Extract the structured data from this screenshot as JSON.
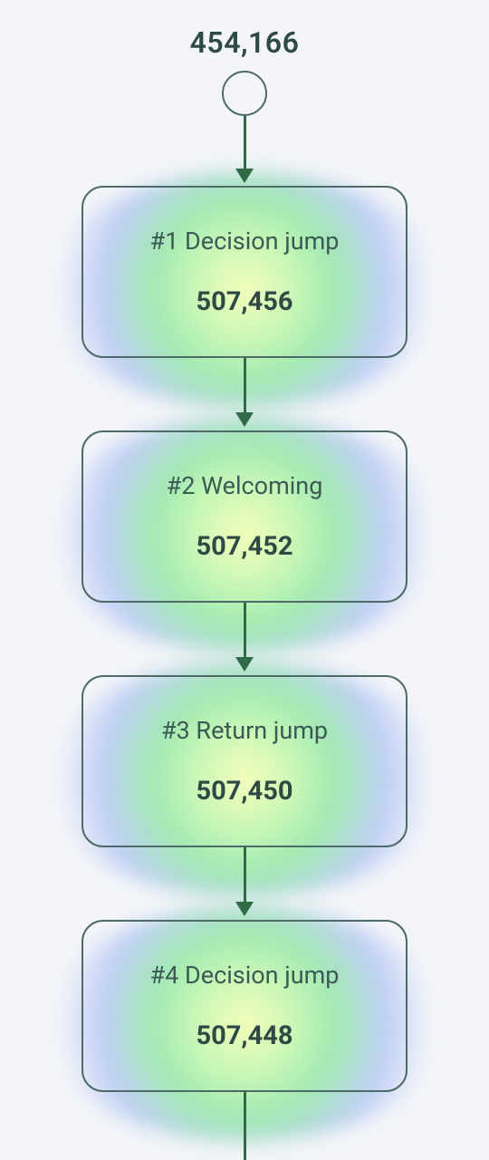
{
  "diagram": {
    "start_value": "454,166",
    "nodes": [
      {
        "title": "#1 Decision jump",
        "value": "507,456"
      },
      {
        "title": "#2 Welcoming",
        "value": "507,452"
      },
      {
        "title": "#3 Return jump",
        "value": "507,450"
      },
      {
        "title": "#4 Decision jump",
        "value": "507,448"
      }
    ]
  },
  "colors": {
    "border": "#4e6b67",
    "arrow": "#2e6b46",
    "text_dark": "#2f4a45",
    "heat_center": "#f7ffb4",
    "heat_mid": "#8ce6a0",
    "heat_outer": "#96aff5"
  }
}
